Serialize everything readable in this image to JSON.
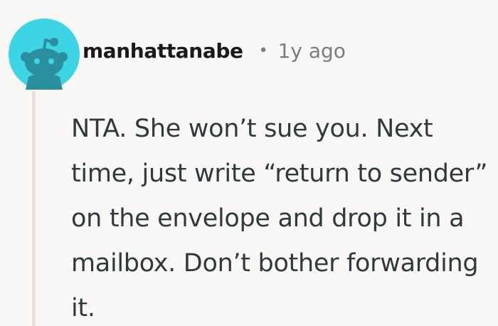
{
  "comment": {
    "username": "manhattanabe",
    "separator": "•",
    "time_ago": "1y ago",
    "body": "NTA. She won’t sue you. Next time, just write “return to sender” on the envelope and drop it in a mailbox. Don’t bother forwarding it.",
    "avatar_icon": "reddit-snoo-avatar-icon"
  },
  "colors": {
    "background": "#f9f8f6",
    "avatar_bg": "#3dd5e6",
    "avatar_figure": "#2c8f9d",
    "thread_line": "#e9e0d8",
    "text": "#2e3b3d",
    "meta": "#7c7c7c"
  }
}
